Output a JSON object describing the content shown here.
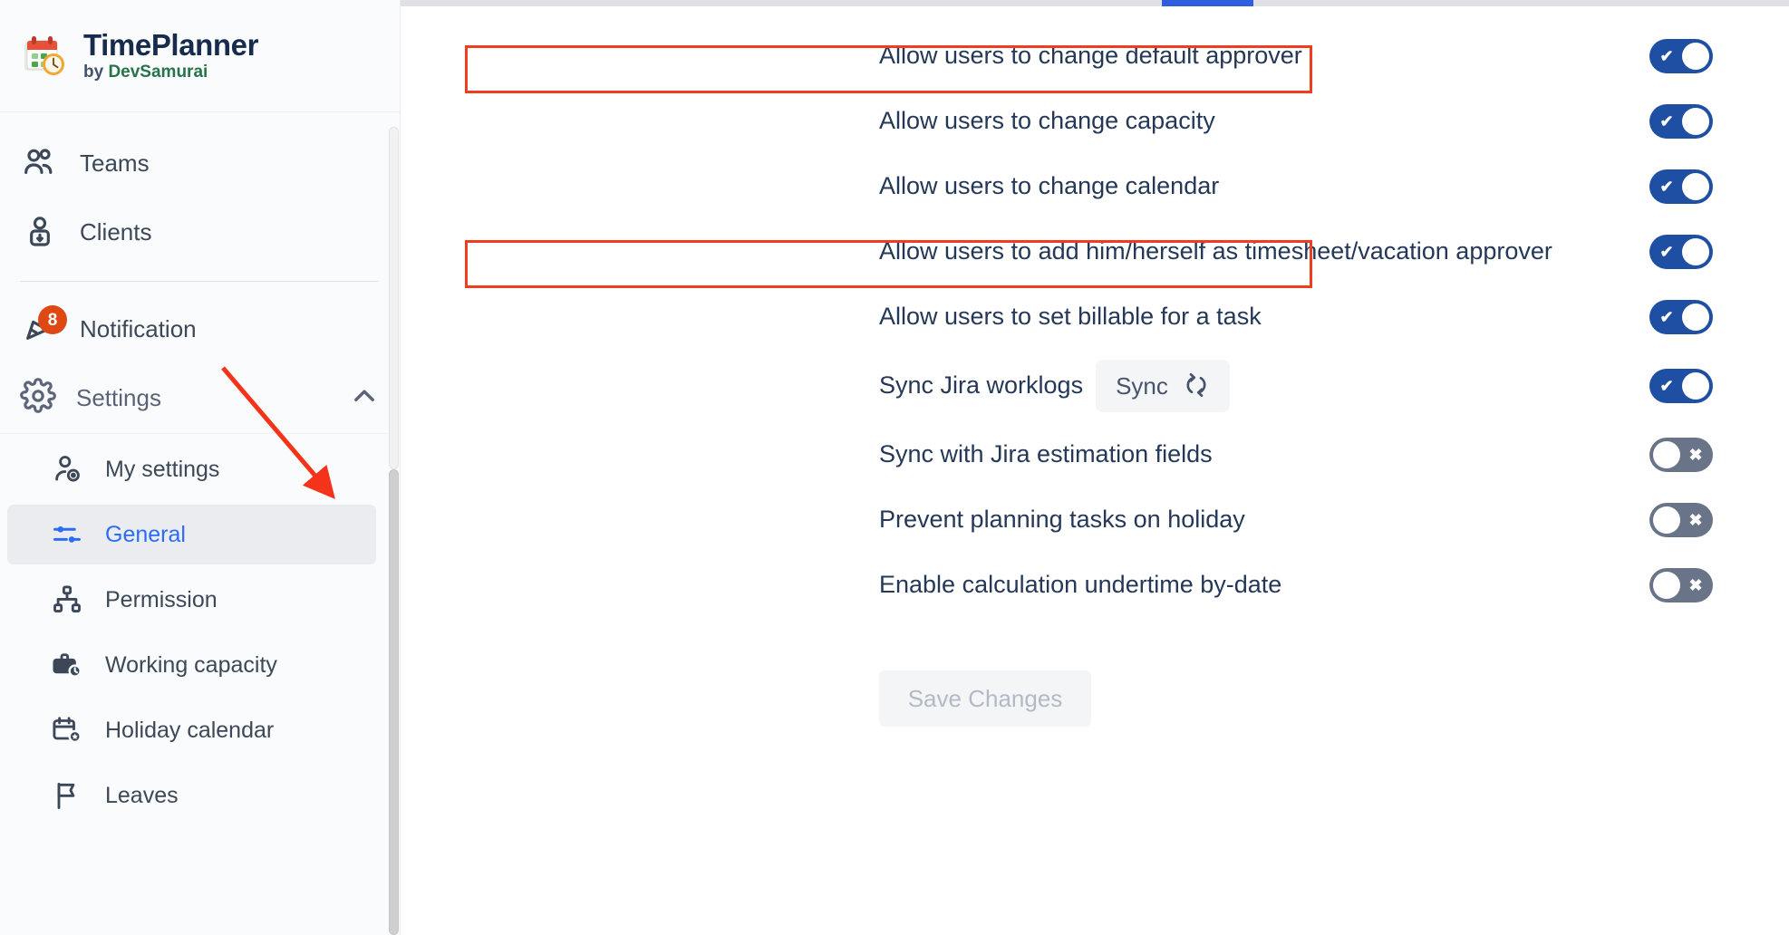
{
  "brand": {
    "title": "TimePlanner",
    "by": "by ",
    "vendor": "DevSamurai",
    "logo_icon": "calendar-clock-icon"
  },
  "sidebar": {
    "items": [
      {
        "label": "Teams",
        "icon": "people-group-icon"
      },
      {
        "label": "Clients",
        "icon": "client-lock-icon"
      }
    ],
    "notification": {
      "label": "Notification",
      "icon": "bell-icon",
      "badge": "8"
    },
    "settings": {
      "label": "Settings",
      "icon": "gear-icon",
      "chevron": "chevron-up-icon"
    },
    "sub_items": [
      {
        "label": "My settings",
        "icon": "user-settings-icon",
        "active": false
      },
      {
        "label": "General",
        "icon": "sliders-icon",
        "active": true
      },
      {
        "label": "Permission",
        "icon": "org-chart-icon",
        "active": false
      },
      {
        "label": "Working capacity",
        "icon": "briefcase-clock-icon",
        "active": false
      },
      {
        "label": "Holiday calendar",
        "icon": "calendar-star-icon",
        "active": false
      },
      {
        "label": "Leaves",
        "icon": "flag-icon",
        "active": false
      }
    ]
  },
  "main": {
    "options": [
      {
        "label": "Allow users to change default approver",
        "state": "on",
        "highlighted": true
      },
      {
        "label": "Allow users to change capacity",
        "state": "on",
        "highlighted": false
      },
      {
        "label": "Allow users to change calendar",
        "state": "on",
        "highlighted": false
      },
      {
        "label": "Allow users to add him/herself as timesheet/vacation approver",
        "state": "on",
        "highlighted": true
      },
      {
        "label": "Allow users to set billable for a task",
        "state": "on",
        "highlighted": false
      },
      {
        "label": "Sync Jira worklogs",
        "state": "on",
        "highlighted": false,
        "button": "Sync",
        "button_icon": "refresh-icon"
      },
      {
        "label": "Sync with Jira estimation fields",
        "state": "off",
        "highlighted": false
      },
      {
        "label": "Prevent planning tasks on holiday",
        "state": "off",
        "highlighted": false
      },
      {
        "label": "Enable calculation undertime by-date",
        "state": "off",
        "highlighted": false
      }
    ],
    "save_button": "Save Changes",
    "toggle_on_glyph": "✔",
    "toggle_off_glyph": "✖"
  },
  "colors": {
    "toggle_on": "#1f4fa3",
    "toggle_off": "#697488",
    "accent_blue": "#2a6df5",
    "annotation_red": "#ef3d20",
    "badge_orange": "#dd4814",
    "vendor_green": "#27734a",
    "tab_indicator": "#2f5fe0"
  }
}
